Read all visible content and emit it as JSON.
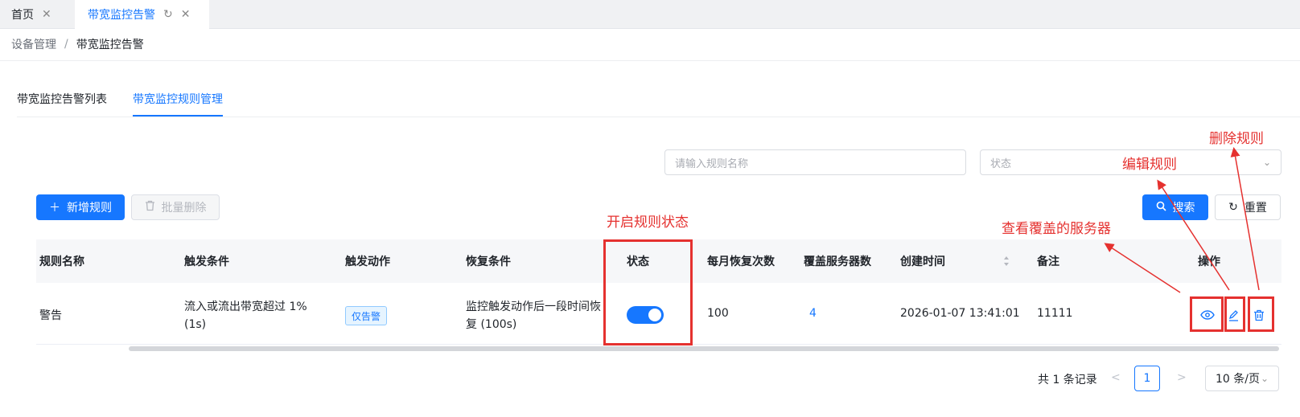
{
  "tabs": {
    "home": "首页",
    "active": "带宽监控告警"
  },
  "breadcrumb": {
    "parent": "设备管理",
    "separator": "/",
    "current": "带宽监控告警"
  },
  "inner_tabs": {
    "tab1": "带宽监控告警列表",
    "tab2": "带宽监控规则管理"
  },
  "filters": {
    "name_placeholder": "请输入规则名称",
    "status_placeholder": "状态"
  },
  "toolbar": {
    "add_label": "新增规则",
    "batch_delete_label": "批量删除",
    "search_label": "搜索",
    "reset_label": "重置"
  },
  "table": {
    "headers": [
      "规则名称",
      "触发条件",
      "触发动作",
      "恢复条件",
      "状态",
      "每月恢复次数",
      "覆盖服务器数",
      "创建时间",
      "备注",
      "操作"
    ],
    "row": {
      "name": "警告",
      "trigger_line1": "流入或流出带宽超过 1%",
      "trigger_line2": "(1s)",
      "action": "仅告警",
      "recover_line1": "监控触发动作后一段时间恢",
      "recover_line2": "复 (100s)",
      "status_on": true,
      "monthly_recover": "100",
      "servers": "4",
      "created": "2026-01-07 13:41:01",
      "remark": "11111"
    }
  },
  "pagination": {
    "total": "共 1 条记录",
    "current_page": "1",
    "page_size": "10 条/页"
  },
  "annotations": {
    "status": "开启规则状态",
    "view": "查看覆盖的服务器",
    "edit": "编辑规则",
    "delete": "删除规则"
  },
  "colors": {
    "accent": "#1677ff",
    "annotation": "#e5312f"
  }
}
